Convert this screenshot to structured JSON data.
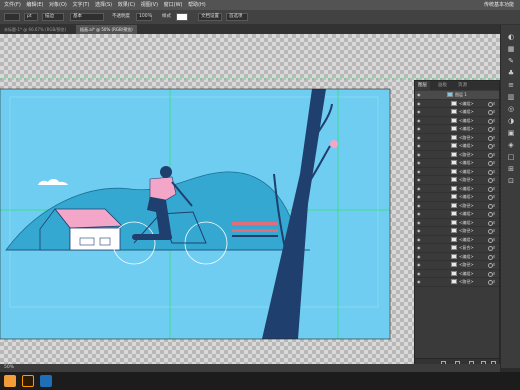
{
  "menubar": {
    "items": [
      "文件(F)",
      "编辑(E)",
      "对象(O)",
      "文字(T)",
      "选择(S)",
      "效果(C)",
      "视图(V)",
      "窗口(W)",
      "帮助(H)"
    ],
    "workspace_label": "传统基本功能"
  },
  "controlbar": {
    "stroke_label": "描边",
    "stroke_weight": "pt",
    "brush_label": "基本",
    "opacity_label": "不透明度",
    "opacity_value": "100%",
    "style_label": "样式",
    "align_label": "文档设置",
    "prefs_label": "首选项"
  },
  "tabs": [
    {
      "label": "未标题-1* @ 66.67% (RGB/预览)",
      "active": false
    },
    {
      "label": "插画.ai* @ 50% (RGB/预览)",
      "active": true
    }
  ],
  "layers_panel": {
    "tabs": [
      "图层",
      "画板",
      "资源"
    ],
    "top_layer": "图层 1",
    "items": [
      "<编组>",
      "<编组>",
      "<编组>",
      "<编组>",
      "<路径>",
      "<编组>",
      "<路径>",
      "<编组>",
      "<编组>",
      "<路径>",
      "<编组>",
      "<编组>",
      "<路径>",
      "<编组>",
      "<编组>",
      "<路径>",
      "<编组>",
      "<复合>",
      "<编组>",
      "<路径>",
      "<编组>",
      "<路径>"
    ]
  },
  "statusbar": {
    "zoom": "50%"
  },
  "colors": {
    "sky": "#6ecdf0",
    "hill": "#35a8d2",
    "tree": "#1f3f6e",
    "roof": "#f3a6c8",
    "guide": "#2ee36e"
  }
}
